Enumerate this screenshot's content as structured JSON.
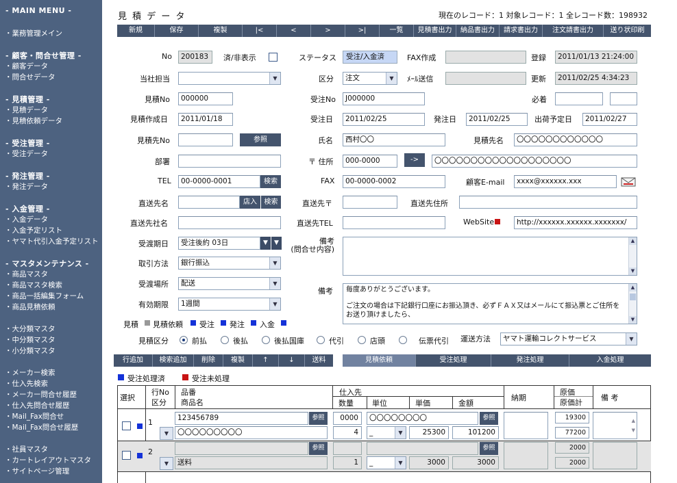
{
  "sidebar": {
    "main_menu": "- MAIN MENU -",
    "items_main": [
      "・業務管理メイン"
    ],
    "sec_customer": "- 顧客・問合せ管理 -",
    "customer_items": [
      "・顧客データ",
      "・問合せデータ"
    ],
    "sec_estimate": "- 見積管理 -",
    "estimate_items": [
      "・見積データ",
      "・見積依頼データ"
    ],
    "sec_order": "- 受注管理 -",
    "order_items": [
      "・受注データ"
    ],
    "sec_purchase": "- 発注管理 -",
    "purchase_items": [
      "・発注データ"
    ],
    "sec_payment": "- 入金管理 -",
    "payment_items": [
      "・入金データ",
      "・入金予定リスト",
      "・ヤマト代引入金予定リスト"
    ],
    "sec_master": "- マスタメンテナンス -",
    "master_items": [
      "・商品マスタ",
      "・商品マスタ検索",
      "・商品一括編集フォーム",
      "・商品見積依頼"
    ],
    "cat_items": [
      "・大分類マスタ",
      "・中分類マスタ",
      "・小分類マスタ"
    ],
    "maker_items": [
      "・メーカー検索",
      "・仕入先検索",
      "・メーカー問合せ履歴",
      "・仕入先問合せ履歴",
      "・Mail_Fax問合せ",
      "・Mail_Fax問合せ履歴"
    ],
    "other_items": [
      "・社員マスタ",
      "・カートレイアウトマスタ",
      "・サイトページ管理"
    ]
  },
  "header": {
    "title": "見 積 デ ー タ",
    "record_info": "現在のレコード：1 対象レコード：1 全レコード数：198932"
  },
  "toolbar": [
    "新規",
    "保存",
    "複製",
    "|<",
    "<",
    ">",
    ">|",
    "一覧",
    "見積書出力",
    "納品書出力",
    "請求書出力",
    "注文請書出力",
    "送り状印刷"
  ],
  "form": {
    "no_label": "No",
    "no_value": "200183",
    "hide_label": "済/非表示",
    "status_label": "ステータス",
    "status_value": "受注/入金済",
    "fax_label": "FAX作成",
    "reg_label": "登録",
    "reg_value": "2011/01/13 21:24:00",
    "tanto_label": "当社担当",
    "kubun_label": "区分",
    "kubun_value": "注文",
    "mail_label": "ﾒｰﾙ送信",
    "upd_label": "更新",
    "upd_value": "2011/02/25 4:34:23",
    "estno_label": "見積No",
    "estno_value": "000000",
    "jno_label": "受注No",
    "jno_value": "J000000",
    "hichaku_label": "必着",
    "estdate_label": "見積作成日",
    "estdate_value": "2011/01/18",
    "jdate_label": "受注日",
    "jdate_value": "2011/02/25",
    "hdate_label": "発注日",
    "hdate_value": "2011/02/25",
    "shipdate_label": "出荷予定日",
    "shipdate_value": "2011/02/27",
    "estto_label": "見積先No",
    "ref_btn": "参照",
    "name_label": "氏名",
    "name_value": "西村〇〇",
    "esttoname_label": "見積先名",
    "esttoname_value": "〇〇〇〇〇〇〇〇〇〇〇〇",
    "dept_label": "部署",
    "zip_label": "〒 住所",
    "zip_value": "000-0000",
    "arrow_btn": "->",
    "addr_value": "〇〇〇〇〇〇〇〇〇〇〇〇〇〇〇〇〇〇〇",
    "tel_label": "TEL",
    "tel_value": "00-0000-0001",
    "search_btn": "検索",
    "fax_no_label": "FAX",
    "fax_value": "00-0000-0002",
    "email_label": "顧客E-mail",
    "email_value": "xxxx@xxxxxx.xxx",
    "ship_label": "直送先名",
    "shop_btn": "店入",
    "shipzip_label": "直送先〒",
    "shipaddr_label": "直送先住所",
    "shipco_label": "直送先社名",
    "shiptel_label": "直送先TEL",
    "web_label": "WebSite",
    "web_value": "http://xxxxxx.xxxxxx.xxxxxxx/",
    "deliv_label": "受渡期日",
    "deliv_value": "受注後約 03日",
    "bikou1_label": "備考\n(問合せ内容)",
    "pay_label": "取引方法",
    "pay_value": "銀行振込",
    "place_label": "受渡場所",
    "place_value": "配送",
    "bikou2_label": "備考",
    "bikou2_text1": "毎度ありがとうございます。",
    "bikou2_text2": "ご注文の場合は下記銀行口座にお振込頂き、必ずＦＡＸ又はメールにて振込票とご住所を",
    "bikou2_text3": "お送り頂けましたら、",
    "valid_label": "有効期限",
    "valid_value": "1週間",
    "legend_est": "見積",
    "legend_req": "見積依頼",
    "legend_ord": "受注",
    "legend_pur": "発注",
    "legend_pay": "入金",
    "estkubun_label": "見積区分",
    "radios": [
      "前払",
      "後払",
      "後払国庫",
      "代引",
      "店頭",
      "伝票代引"
    ],
    "carrier_label": "運送方法",
    "carrier_value": "ヤマト運輸コレクトサービス"
  },
  "actions": [
    "行追加",
    "検索追加",
    "削除",
    "複製",
    "↑",
    "↓",
    "送料"
  ],
  "process_tabs": [
    "見積依頼",
    "受注処理",
    "発注処理",
    "入金処理"
  ],
  "legend2": {
    "done": "受注処理済",
    "notdone": "受注未処理"
  },
  "table": {
    "h_select": "選択",
    "h_rowno": "行No",
    "h_kubun": "区分",
    "h_hinban": "品番",
    "h_hinmei": "商品名",
    "h_supplier": "仕入先",
    "h_qty": "数量",
    "h_unit": "単位",
    "h_price": "単価",
    "h_amount": "金額",
    "h_noki": "納期",
    "h_cost": "原価",
    "h_costtotal": "原価計",
    "h_note": "備 考",
    "rows": [
      {
        "no": "1",
        "hinban": "123456789",
        "hinmei": "〇〇〇〇〇〇〇〇〇",
        "sup_code": "0000",
        "sup_name": "〇〇〇〇〇〇〇〇",
        "qty": "4",
        "unit": "_",
        "price": "25300",
        "amount": "101200",
        "cost": "19300",
        "costtotal": "77200"
      },
      {
        "no": "2",
        "hinban": "",
        "hinmei": "送料",
        "sup_code": "",
        "sup_name": "",
        "qty": "1",
        "unit": "_",
        "price": "3000",
        "amount": "3000",
        "cost": "2000",
        "costtotal": "2000"
      }
    ]
  }
}
